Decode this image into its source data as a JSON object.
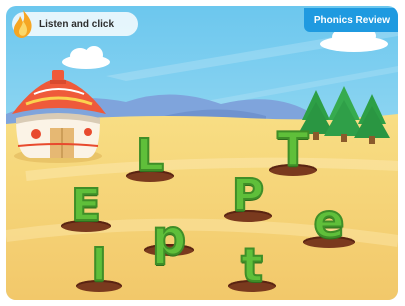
{
  "instruction": {
    "label": "Listen and click",
    "icon": "flame-icon"
  },
  "review_button": {
    "label": "Phonics Review"
  },
  "letters": [
    {
      "char": "L",
      "name": "letter-L"
    },
    {
      "char": "T",
      "name": "letter-T"
    },
    {
      "char": "E",
      "name": "letter-E"
    },
    {
      "char": "P",
      "name": "letter-P"
    },
    {
      "char": "p",
      "name": "letter-p"
    },
    {
      "char": "e",
      "name": "letter-e"
    },
    {
      "char": "l",
      "name": "letter-l"
    },
    {
      "char": "t",
      "name": "letter-t"
    }
  ],
  "colors": {
    "sky": "#8fd6f2",
    "ground": "#f6d77a",
    "accent": "#1f9ae0",
    "letter": "#5fbf3a"
  }
}
